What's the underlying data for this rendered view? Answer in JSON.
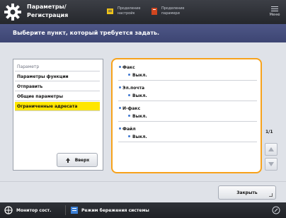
{
  "header": {
    "title_line1": "Параметры/",
    "title_line2": "Регистрация",
    "btn_left_line1": "Проделение",
    "btn_left_line2": "настройк",
    "btn_right_line1": "Проделение",
    "btn_right_line2": "парамери",
    "menu_label": "Меню",
    "gear_icon": "gear-icon",
    "accent": "#ffffff"
  },
  "instruction": "Выберите пункт, который требуется задать.",
  "tree": {
    "items": [
      {
        "label": "Параметр"
      },
      {
        "label": "Параметры функции"
      },
      {
        "label": "Отправить"
      },
      {
        "label": "Общие параметры"
      },
      {
        "label": "Ограниченные адресата"
      }
    ],
    "selected_index": 4,
    "up_button_label": "Вверх"
  },
  "details": {
    "groups": [
      {
        "name": "Факс",
        "value": "Выкл."
      },
      {
        "name": "Эл.почта",
        "value": "Выкл."
      },
      {
        "name": "И-факс",
        "value": "Выкл."
      },
      {
        "name": "Файл",
        "value": "Выкл."
      }
    ],
    "border_color": "#f7a21b"
  },
  "pager": {
    "text": "1/1"
  },
  "close_button": "Закрыть",
  "status_bar": {
    "left_label": "Монитор сост.",
    "right_label": "Режим бережения системы"
  },
  "colors": {
    "header_bg": "#2e3137",
    "instruction_bg": "#454d7d",
    "selected_bg": "#ffe600",
    "bullet": "#3f78d0"
  }
}
